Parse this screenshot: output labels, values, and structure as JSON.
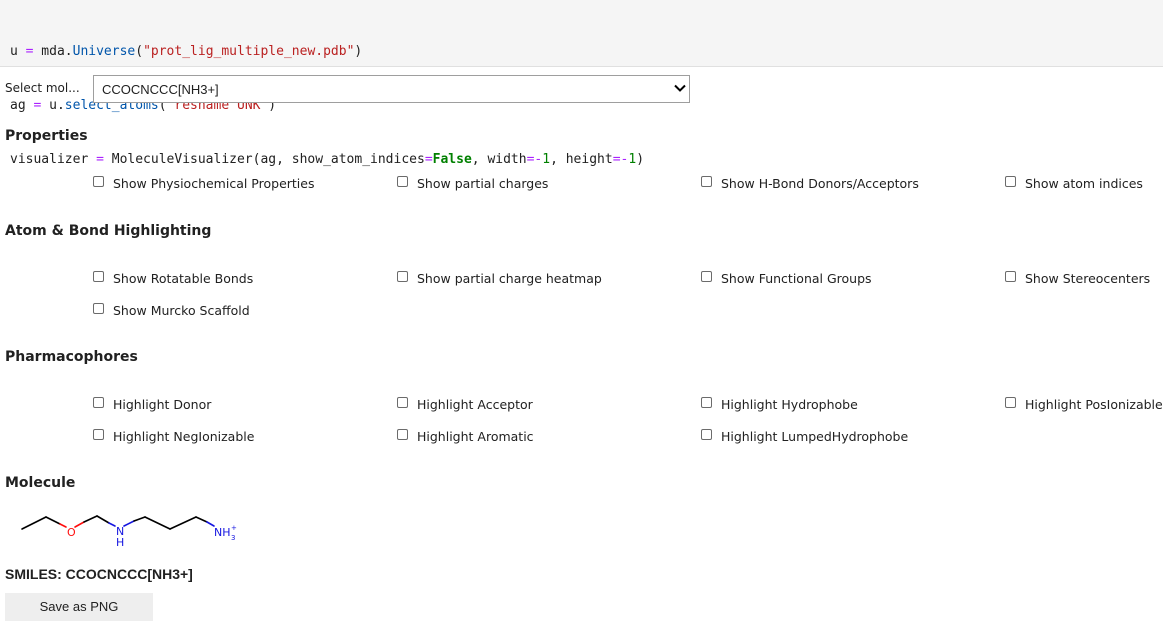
{
  "code": {
    "line1": {
      "a": "u ",
      "b": "=",
      "c": " mda.",
      "d": "Universe",
      "e": "(",
      "f": "\"prot_lig_multiple_new.pdb\"",
      "g": ")"
    },
    "line2": {
      "a": "ag ",
      "b": "=",
      "c": " u.",
      "d": "select_atoms",
      "e": "(",
      "f": "\"resname UNK\"",
      "g": ")"
    },
    "line3": {
      "a": "visualizer ",
      "b": "=",
      "c": " MoleculeVisualizer(ag, show_atom_indices",
      "d": "=",
      "e": "False",
      "f": ", width",
      "g": "=-",
      "h": "1",
      "i": ", height",
      "j": "=-",
      "k": "1",
      "l": ")"
    }
  },
  "selector": {
    "label": "Select mol...",
    "value": "CCOCNCCC[NH3+]"
  },
  "sections": {
    "properties": {
      "title": "Properties",
      "options": [
        "Show Physiochemical Properties",
        "Show partial charges",
        "Show H-Bond Donors/Acceptors",
        "Show atom indices"
      ]
    },
    "highlighting": {
      "title": "Atom & Bond Highlighting",
      "options": [
        "Show Rotatable Bonds",
        "Show partial charge heatmap",
        "Show Functional Groups",
        "Show Stereocenters",
        "Show Murcko Scaffold"
      ]
    },
    "pharmacophores": {
      "title": "Pharmacophores",
      "options": [
        "Highlight Donor",
        "Highlight Acceptor",
        "Highlight Hydrophobe",
        "Highlight PosIonizable",
        "Highlight NegIonizable",
        "Highlight Aromatic",
        "Highlight LumpedHydrophobe"
      ]
    },
    "molecule": {
      "title": "Molecule",
      "atoms": {
        "o": "O",
        "n": "N",
        "h": "H",
        "nh": "NH",
        "sub": "3",
        "sup": "+"
      }
    }
  },
  "smiles_text": "SMILES: CCOCNCCC[NH3+]",
  "save_button": "Save as PNG",
  "colors": {
    "oxygen": "#ff0d0d",
    "nitrogen": "#1515e0",
    "bond": "#000000"
  },
  "icons": {
    "select": "chevron-down-icon"
  }
}
